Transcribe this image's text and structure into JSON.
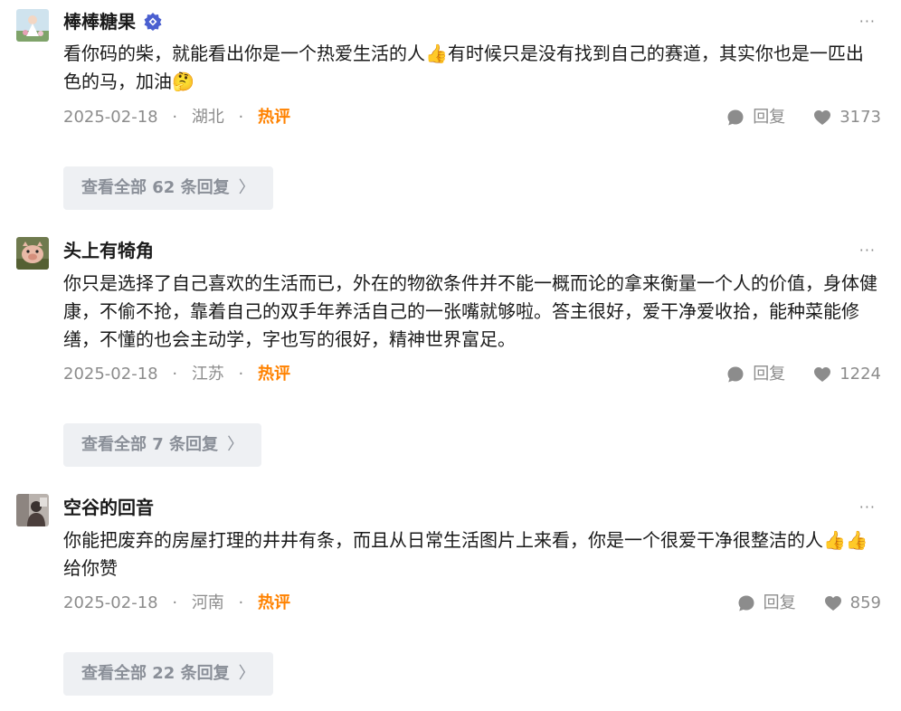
{
  "comments": [
    {
      "user": "棒棒糖果",
      "verified": true,
      "text": "看你码的柴，就能看出你是一个热爱生活的人👍有时候只是没有找到自己的赛道，其实你也是一匹出色的马，加油🤔",
      "date": "2025-02-18",
      "location": "湖北",
      "hot_label": "热评",
      "reply_label": "回复",
      "likes": "3173",
      "more_replies": "查看全部 62 条回复"
    },
    {
      "user": "头上有犄角",
      "verified": false,
      "text": "你只是选择了自己喜欢的生活而已，外在的物欲条件并不能一概而论的拿来衡量一个人的价值，身体健康，不偷不抢，靠着自己的双手年养活自己的一张嘴就够啦。答主很好，爱干净爱收拾，能种菜能修缮，不懂的也会主动学，字也写的很好，精神世界富足。",
      "date": "2025-02-18",
      "location": "江苏",
      "hot_label": "热评",
      "reply_label": "回复",
      "likes": "1224",
      "more_replies": "查看全部 7 条回复"
    },
    {
      "user": "空谷的回音",
      "verified": false,
      "text": "你能把废弃的房屋打理的井井有条，而且从日常生活图片上来看，你是一个很爱干净很整洁的人👍👍给你赞",
      "date": "2025-02-18",
      "location": "河南",
      "hot_label": "热评",
      "reply_label": "回复",
      "likes": "859",
      "more_replies": "查看全部 22 条回复"
    }
  ],
  "colors": {
    "hot": "#ff8200",
    "meta": "#8c8c8c",
    "verified_badge": "#4a5fd0",
    "more_bg": "#eef0f3"
  }
}
